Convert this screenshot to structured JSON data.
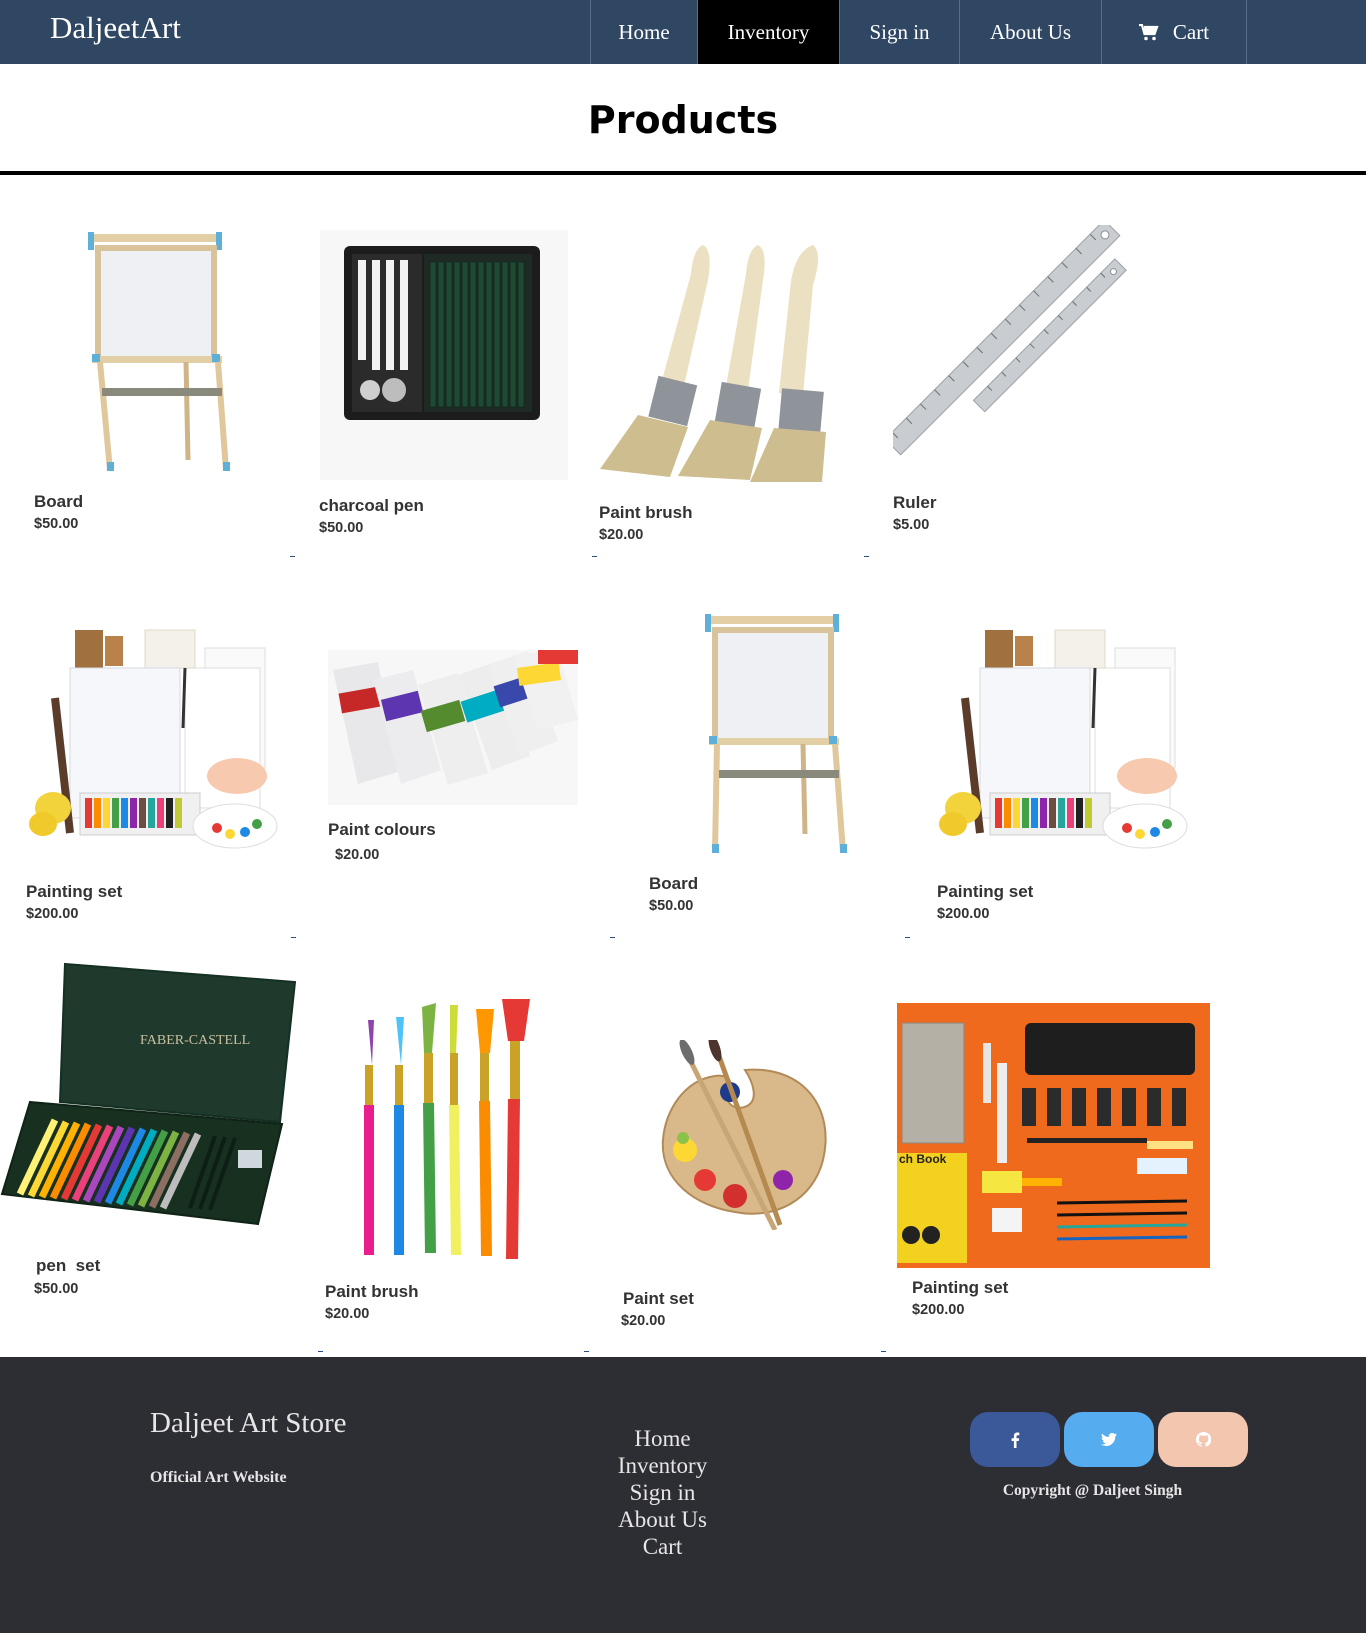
{
  "navbar": {
    "brand": "DaljeetArt",
    "items": [
      {
        "label": "Home"
      },
      {
        "label": "Inventory"
      },
      {
        "label": "Sign in"
      },
      {
        "label": "About Us"
      },
      {
        "label": "Cart"
      }
    ],
    "active": "Inventory",
    "colors": {
      "bar": "#2f4763",
      "active": "#000000"
    }
  },
  "page": {
    "title": "Products"
  },
  "products": [
    {
      "name": "Board",
      "price": "$50.00",
      "image": "easel-board"
    },
    {
      "name": "charcoal pen",
      "price": "$50.00",
      "image": "charcoal-pencil-kit"
    },
    {
      "name": "Paint brush",
      "price": "$20.00",
      "image": "flat-paint-brushes"
    },
    {
      "name": "Ruler",
      "price": "$5.00",
      "image": "steel-rulers"
    },
    {
      "name": "Painting set",
      "price": "$200.00",
      "image": "painting-set"
    },
    {
      "name": "Paint colours",
      "price": "$20.00",
      "image": "paint-tubes"
    },
    {
      "name": "Board",
      "price": "$50.00",
      "image": "easel-board"
    },
    {
      "name": "Painting set",
      "price": "$200.00",
      "image": "painting-set"
    },
    {
      "name": "pen  set",
      "price": "$50.00",
      "image": "colored-pencil-case"
    },
    {
      "name": "Paint brush",
      "price": "$20.00",
      "image": "colorful-brushes"
    },
    {
      "name": "Paint set",
      "price": "$20.00",
      "image": "palette-with-brushes"
    },
    {
      "name": "Painting set",
      "price": "$200.00",
      "image": "art-supplies-flatlay"
    }
  ],
  "footer": {
    "title": "Daljeet Art Store",
    "subtitle": "Official Art Website",
    "links": [
      "Home",
      "Inventory",
      "Sign in",
      "About Us",
      "Cart"
    ],
    "social": [
      {
        "icon": "facebook-icon",
        "color": "#3b5998"
      },
      {
        "icon": "twitter-icon",
        "color": "#55acee"
      },
      {
        "icon": "github-icon",
        "color": "#f3c6b0"
      }
    ],
    "copyright": "Copyright @ Daljeet Singh",
    "background": "#2d2d34"
  }
}
